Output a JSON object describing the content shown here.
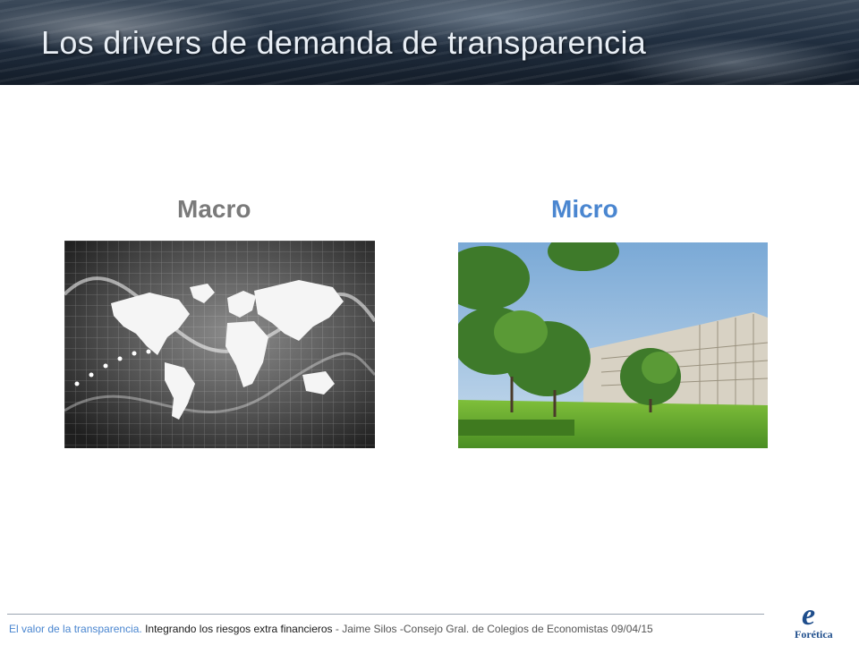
{
  "slide": {
    "title": "Los drivers de demanda de transparencia",
    "macro_label": "Macro",
    "micro_label": "Micro",
    "macro_image": "world-map-grid-image",
    "micro_image": "office-campus-garden-image"
  },
  "footer": {
    "part1": "El valor de la transparencia.",
    "part2": " Integrando los riesgos extra financieros ",
    "part3": " - Jaime Silos  -Consejo Gral. de Colegios de Economistas ",
    "date": "09/04/15"
  },
  "logo": {
    "glyph": "e",
    "text": "Forética",
    "color": "#1f4e8c"
  }
}
